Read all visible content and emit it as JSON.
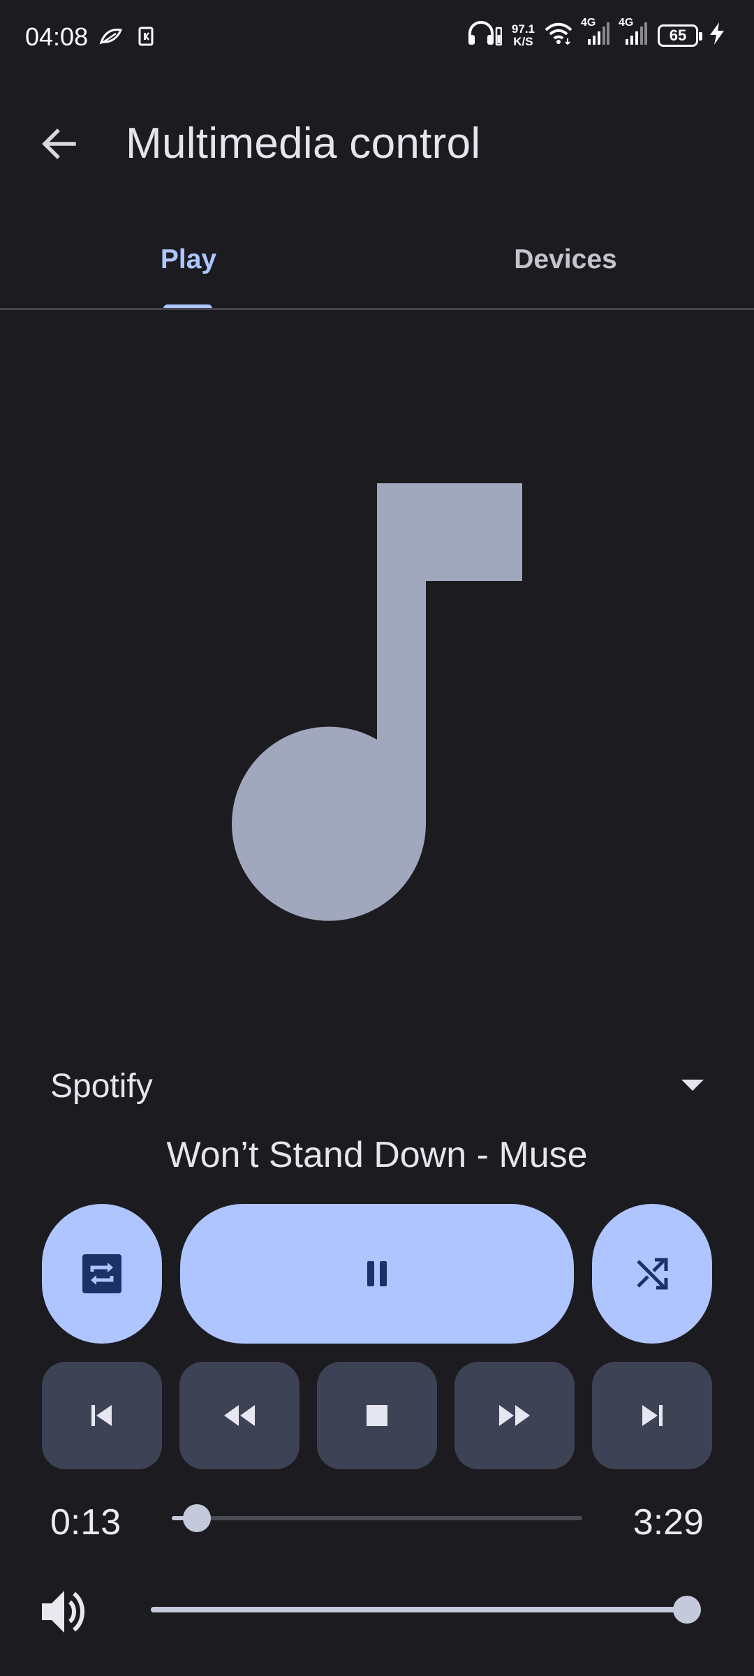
{
  "status_bar": {
    "time": "04:08",
    "speed_value": "97.1",
    "speed_unit": "K/S",
    "network_1": "4G",
    "network_2": "4G",
    "battery": "65"
  },
  "app_bar": {
    "title": "Multimedia control"
  },
  "tabs": [
    {
      "label": "Play",
      "selected": true
    },
    {
      "label": "Devices",
      "selected": false
    }
  ],
  "player": {
    "source": "Spotify",
    "track": "Won’t Stand Down - Muse",
    "current_time": "0:13",
    "total_time": "3:29",
    "progress_fraction": 0.062,
    "volume_fraction": 1.0
  },
  "colors": {
    "background": "#1c1b20",
    "accent": "#aec6ff",
    "primary_button": "#afc5ff",
    "secondary_button": "#3d4354",
    "art": "#a1a7bd"
  }
}
